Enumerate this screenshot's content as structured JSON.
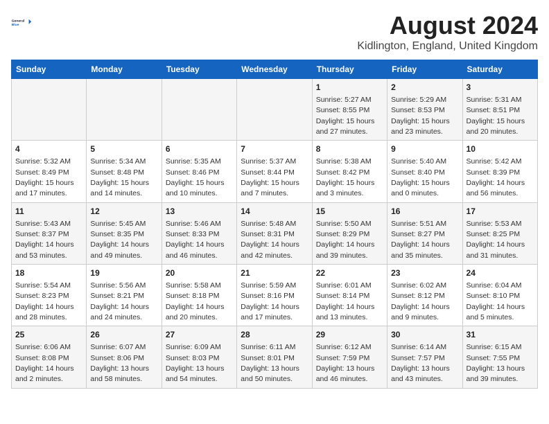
{
  "logo": {
    "line1": "General",
    "line2": "Blue"
  },
  "title": "August 2024",
  "subtitle": "Kidlington, England, United Kingdom",
  "days_of_week": [
    "Sunday",
    "Monday",
    "Tuesday",
    "Wednesday",
    "Thursday",
    "Friday",
    "Saturday"
  ],
  "weeks": [
    [
      {
        "day": "",
        "info": ""
      },
      {
        "day": "",
        "info": ""
      },
      {
        "day": "",
        "info": ""
      },
      {
        "day": "",
        "info": ""
      },
      {
        "day": "1",
        "info": "Sunrise: 5:27 AM\nSunset: 8:55 PM\nDaylight: 15 hours\nand 27 minutes."
      },
      {
        "day": "2",
        "info": "Sunrise: 5:29 AM\nSunset: 8:53 PM\nDaylight: 15 hours\nand 23 minutes."
      },
      {
        "day": "3",
        "info": "Sunrise: 5:31 AM\nSunset: 8:51 PM\nDaylight: 15 hours\nand 20 minutes."
      }
    ],
    [
      {
        "day": "4",
        "info": "Sunrise: 5:32 AM\nSunset: 8:49 PM\nDaylight: 15 hours\nand 17 minutes."
      },
      {
        "day": "5",
        "info": "Sunrise: 5:34 AM\nSunset: 8:48 PM\nDaylight: 15 hours\nand 14 minutes."
      },
      {
        "day": "6",
        "info": "Sunrise: 5:35 AM\nSunset: 8:46 PM\nDaylight: 15 hours\nand 10 minutes."
      },
      {
        "day": "7",
        "info": "Sunrise: 5:37 AM\nSunset: 8:44 PM\nDaylight: 15 hours\nand 7 minutes."
      },
      {
        "day": "8",
        "info": "Sunrise: 5:38 AM\nSunset: 8:42 PM\nDaylight: 15 hours\nand 3 minutes."
      },
      {
        "day": "9",
        "info": "Sunrise: 5:40 AM\nSunset: 8:40 PM\nDaylight: 15 hours\nand 0 minutes."
      },
      {
        "day": "10",
        "info": "Sunrise: 5:42 AM\nSunset: 8:39 PM\nDaylight: 14 hours\nand 56 minutes."
      }
    ],
    [
      {
        "day": "11",
        "info": "Sunrise: 5:43 AM\nSunset: 8:37 PM\nDaylight: 14 hours\nand 53 minutes."
      },
      {
        "day": "12",
        "info": "Sunrise: 5:45 AM\nSunset: 8:35 PM\nDaylight: 14 hours\nand 49 minutes."
      },
      {
        "day": "13",
        "info": "Sunrise: 5:46 AM\nSunset: 8:33 PM\nDaylight: 14 hours\nand 46 minutes."
      },
      {
        "day": "14",
        "info": "Sunrise: 5:48 AM\nSunset: 8:31 PM\nDaylight: 14 hours\nand 42 minutes."
      },
      {
        "day": "15",
        "info": "Sunrise: 5:50 AM\nSunset: 8:29 PM\nDaylight: 14 hours\nand 39 minutes."
      },
      {
        "day": "16",
        "info": "Sunrise: 5:51 AM\nSunset: 8:27 PM\nDaylight: 14 hours\nand 35 minutes."
      },
      {
        "day": "17",
        "info": "Sunrise: 5:53 AM\nSunset: 8:25 PM\nDaylight: 14 hours\nand 31 minutes."
      }
    ],
    [
      {
        "day": "18",
        "info": "Sunrise: 5:54 AM\nSunset: 8:23 PM\nDaylight: 14 hours\nand 28 minutes."
      },
      {
        "day": "19",
        "info": "Sunrise: 5:56 AM\nSunset: 8:21 PM\nDaylight: 14 hours\nand 24 minutes."
      },
      {
        "day": "20",
        "info": "Sunrise: 5:58 AM\nSunset: 8:18 PM\nDaylight: 14 hours\nand 20 minutes."
      },
      {
        "day": "21",
        "info": "Sunrise: 5:59 AM\nSunset: 8:16 PM\nDaylight: 14 hours\nand 17 minutes."
      },
      {
        "day": "22",
        "info": "Sunrise: 6:01 AM\nSunset: 8:14 PM\nDaylight: 14 hours\nand 13 minutes."
      },
      {
        "day": "23",
        "info": "Sunrise: 6:02 AM\nSunset: 8:12 PM\nDaylight: 14 hours\nand 9 minutes."
      },
      {
        "day": "24",
        "info": "Sunrise: 6:04 AM\nSunset: 8:10 PM\nDaylight: 14 hours\nand 5 minutes."
      }
    ],
    [
      {
        "day": "25",
        "info": "Sunrise: 6:06 AM\nSunset: 8:08 PM\nDaylight: 14 hours\nand 2 minutes."
      },
      {
        "day": "26",
        "info": "Sunrise: 6:07 AM\nSunset: 8:06 PM\nDaylight: 13 hours\nand 58 minutes."
      },
      {
        "day": "27",
        "info": "Sunrise: 6:09 AM\nSunset: 8:03 PM\nDaylight: 13 hours\nand 54 minutes."
      },
      {
        "day": "28",
        "info": "Sunrise: 6:11 AM\nSunset: 8:01 PM\nDaylight: 13 hours\nand 50 minutes."
      },
      {
        "day": "29",
        "info": "Sunrise: 6:12 AM\nSunset: 7:59 PM\nDaylight: 13 hours\nand 46 minutes."
      },
      {
        "day": "30",
        "info": "Sunrise: 6:14 AM\nSunset: 7:57 PM\nDaylight: 13 hours\nand 43 minutes."
      },
      {
        "day": "31",
        "info": "Sunrise: 6:15 AM\nSunset: 7:55 PM\nDaylight: 13 hours\nand 39 minutes."
      }
    ]
  ]
}
